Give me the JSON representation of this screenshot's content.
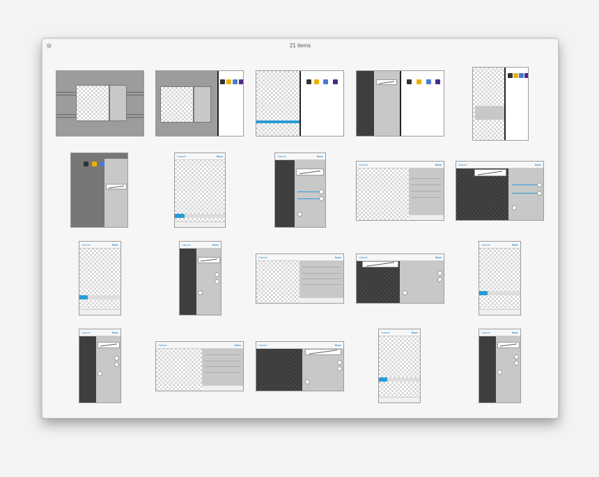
{
  "window": {
    "title": "21 items",
    "close_icon": "close-icon"
  },
  "labels": {
    "cancel": "Cancel",
    "save": "Save"
  },
  "thumbnails": [
    {
      "kind": "sheet-music"
    },
    {
      "kind": "sheet-split"
    },
    {
      "kind": "split-blank"
    },
    {
      "kind": "split-dark"
    },
    {
      "kind": "phone-split"
    },
    {
      "kind": "phone-gray"
    },
    {
      "kind": "phone-checker"
    },
    {
      "kind": "phone-dark"
    },
    {
      "kind": "land-checker"
    },
    {
      "kind": "land-dark"
    },
    {
      "kind": "phone-checker"
    },
    {
      "kind": "phone-dark"
    },
    {
      "kind": "land-checker"
    },
    {
      "kind": "land-dark"
    },
    {
      "kind": "phone-checker"
    },
    {
      "kind": "phone-dark"
    },
    {
      "kind": "land-checker"
    },
    {
      "kind": "land-dark"
    },
    {
      "kind": "phone-checker"
    },
    {
      "kind": "phone-dark"
    }
  ]
}
